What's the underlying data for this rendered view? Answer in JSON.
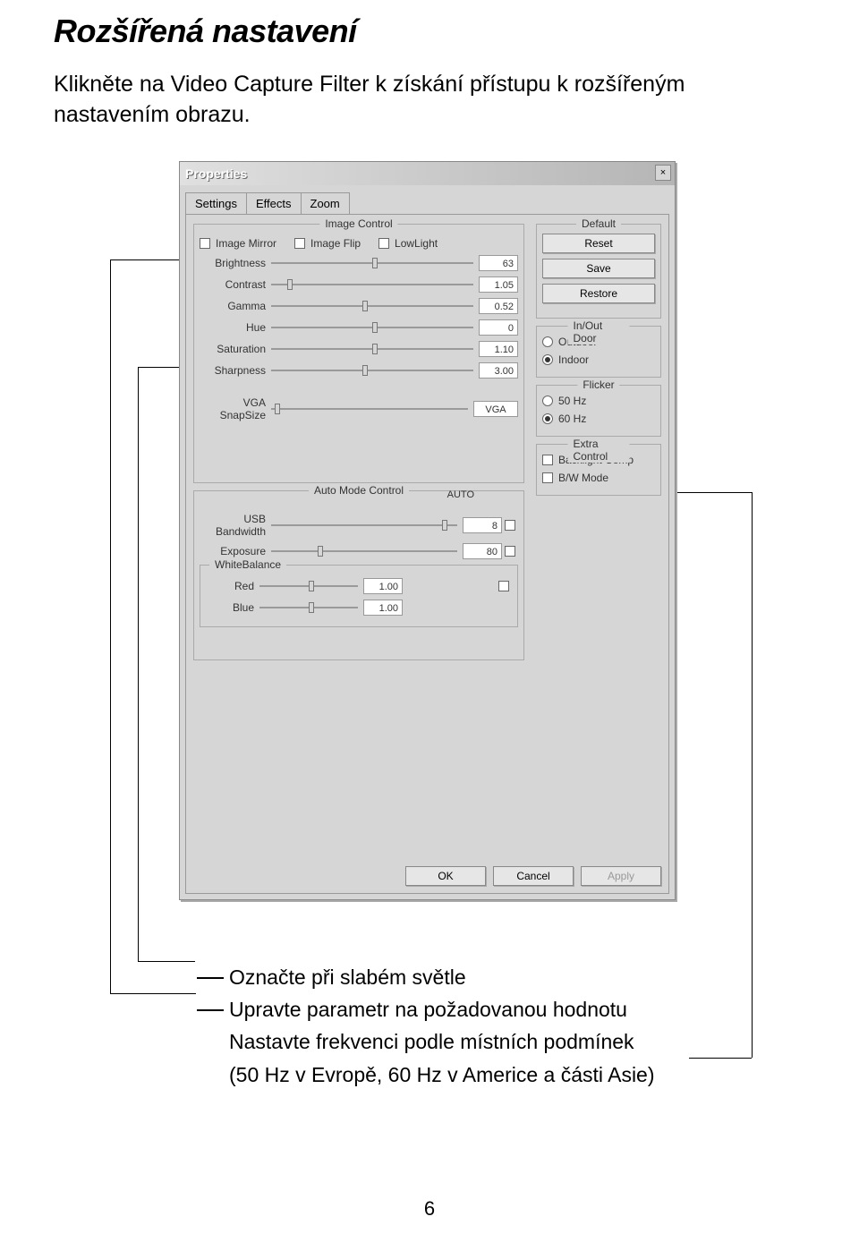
{
  "page": {
    "title": "Rozšířená nastavení",
    "intro": "Klikněte na Video Capture Filter k získání přístupu k rozšířeným nastavením obrazu.",
    "number": "6"
  },
  "dialog": {
    "title": "Properties",
    "tabs": [
      "Settings",
      "Effects",
      "Zoom"
    ],
    "groups": {
      "image_control": "Image Control",
      "auto_mode_control": "Auto Mode Control",
      "white_balance": "WhiteBalance",
      "default": "Default",
      "inout": "In/Out Door",
      "flicker": "Flicker",
      "extra": "Extra Control"
    },
    "checks": {
      "mirror": "Image Mirror",
      "flip": "Image Flip",
      "lowlight": "LowLight"
    },
    "sliders": {
      "brightness": {
        "label": "Brightness",
        "value": "63"
      },
      "contrast": {
        "label": "Contrast",
        "value": "1.05"
      },
      "gamma": {
        "label": "Gamma",
        "value": "0.52"
      },
      "hue": {
        "label": "Hue",
        "value": "0"
      },
      "saturation": {
        "label": "Saturation",
        "value": "1.10"
      },
      "sharpness": {
        "label": "Sharpness",
        "value": "3.00"
      },
      "vga": {
        "label": "VGA SnapSize",
        "value": "VGA"
      },
      "usb": {
        "label": "USB Bandwidth",
        "value": "8"
      },
      "exposure": {
        "label": "Exposure",
        "value": "80"
      },
      "red": {
        "label": "Red",
        "value": "1.00"
      },
      "blue": {
        "label": "Blue",
        "value": "1.00"
      }
    },
    "buttons": {
      "reset": "Reset",
      "save": "Save",
      "restore": "Restore",
      "ok": "OK",
      "cancel": "Cancel",
      "apply": "Apply"
    },
    "radios": {
      "outdoor": "Outdoor",
      "indoor": "Indoor",
      "hz50": "50 Hz",
      "hz60": "60 Hz"
    },
    "extra": {
      "backlight": "Backlight Comp",
      "bw": "B/W Mode"
    },
    "auto": "AUTO"
  },
  "annotations": {
    "a1": "Označte při slabém světle",
    "a2": "Upravte parametr na požadovanou hodnotu",
    "a3": "Nastavte frekvenci podle místních podmínek",
    "a4": "(50 Hz v Evropě, 60 Hz v Americe a části Asie)"
  }
}
